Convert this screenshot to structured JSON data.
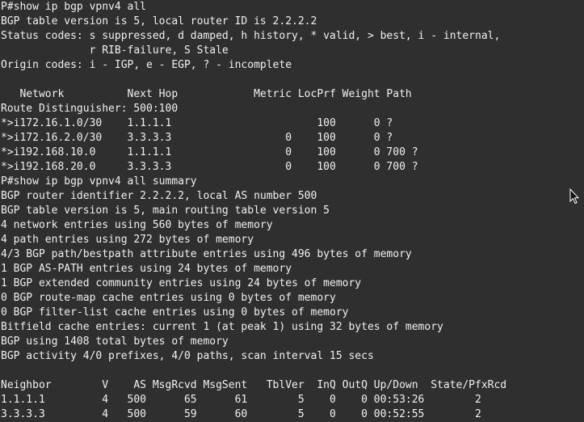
{
  "terminal": {
    "lines": [
      "P#show ip bgp vpnv4 all",
      "BGP table version is 5, local router ID is 2.2.2.2",
      "Status codes: s suppressed, d damped, h history, * valid, > best, i - internal,",
      "              r RIB-failure, S Stale",
      "Origin codes: i - IGP, e - EGP, ? - incomplete",
      "",
      "   Network          Next Hop            Metric LocPrf Weight Path",
      "Route Distinguisher: 500:100",
      "*>i172.16.1.0/30    1.1.1.1                       100      0 ?",
      "*>i172.16.2.0/30    3.3.3.3                  0    100      0 ?",
      "*>i192.168.10.0     1.1.1.1                  0    100      0 700 ?",
      "*>i192.168.20.0     3.3.3.3                  0    100      0 700 ?",
      "P#show ip bgp vpnv4 all summary",
      "BGP router identifier 2.2.2.2, local AS number 500",
      "BGP table version is 5, main routing table version 5",
      "4 network entries using 560 bytes of memory",
      "4 path entries using 272 bytes of memory",
      "4/3 BGP path/bestpath attribute entries using 496 bytes of memory",
      "1 BGP AS-PATH entries using 24 bytes of memory",
      "1 BGP extended community entries using 24 bytes of memory",
      "0 BGP route-map cache entries using 0 bytes of memory",
      "0 BGP filter-list cache entries using 0 bytes of memory",
      "Bitfield cache entries: current 1 (at peak 1) using 32 bytes of memory",
      "BGP using 1408 total bytes of memory",
      "BGP activity 4/0 prefixes, 4/0 paths, scan interval 15 secs",
      "",
      "Neighbor        V    AS MsgRcvd MsgSent   TblVer  InQ OutQ Up/Down  State/PfxRcd",
      "1.1.1.1         4   500      65      61        5    0    0 00:53:26        2",
      "3.3.3.3         4   500      59      60        5    0    0 00:52:55        2"
    ]
  },
  "icons": {
    "cursor": "mouse-pointer-icon"
  },
  "colors": {
    "background": "#2f2f2f",
    "text": "#f0f0f0"
  }
}
